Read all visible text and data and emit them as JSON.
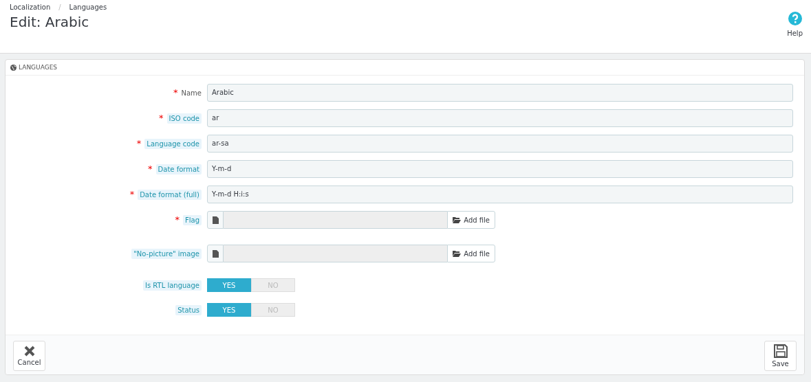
{
  "breadcrumb": [
    {
      "label": "Localization"
    },
    {
      "separator": "/"
    },
    {
      "label": "Languages"
    }
  ],
  "page_title": "Edit: Arabic",
  "toolbar": [
    {
      "label": "Help"
    }
  ],
  "panel": {
    "heading": "LANGUAGES",
    "fields": [
      {
        "kind": "text",
        "label": "Name",
        "required_mark": "*",
        "hint": false,
        "value": "Arabic"
      },
      {
        "kind": "text",
        "label": "ISO code",
        "required_mark": "*",
        "hint": true,
        "value": "ar"
      },
      {
        "kind": "text",
        "label": "Language code",
        "required_mark": "*",
        "hint": true,
        "value": "ar-sa"
      },
      {
        "kind": "text",
        "label": "Date format",
        "required_mark": "*",
        "hint": true,
        "value": "Y-m-d"
      },
      {
        "kind": "text",
        "label": "Date format (full)",
        "required_mark": "*",
        "hint": true,
        "value": "Y-m-d H:i:s"
      },
      {
        "kind": "file",
        "label": "Flag",
        "required_mark": "*",
        "hint": true,
        "button": "Add file"
      },
      {
        "kind": "file",
        "label": "\"No-picture\" image",
        "hint": true,
        "button": "Add file"
      },
      {
        "kind": "switch",
        "label": "Is RTL language",
        "hint": true,
        "options": [
          {
            "label": "YES",
            "selected": true
          },
          {
            "label": "NO",
            "selected": false
          }
        ]
      },
      {
        "kind": "switch",
        "label": "Status",
        "hint": true,
        "options": [
          {
            "label": "YES",
            "selected": true
          },
          {
            "label": "NO",
            "selected": false
          }
        ]
      }
    ],
    "footer_buttons": [
      {
        "kind": "cancel",
        "label": "Cancel"
      },
      {
        "kind": "save",
        "label": "Save"
      }
    ]
  }
}
